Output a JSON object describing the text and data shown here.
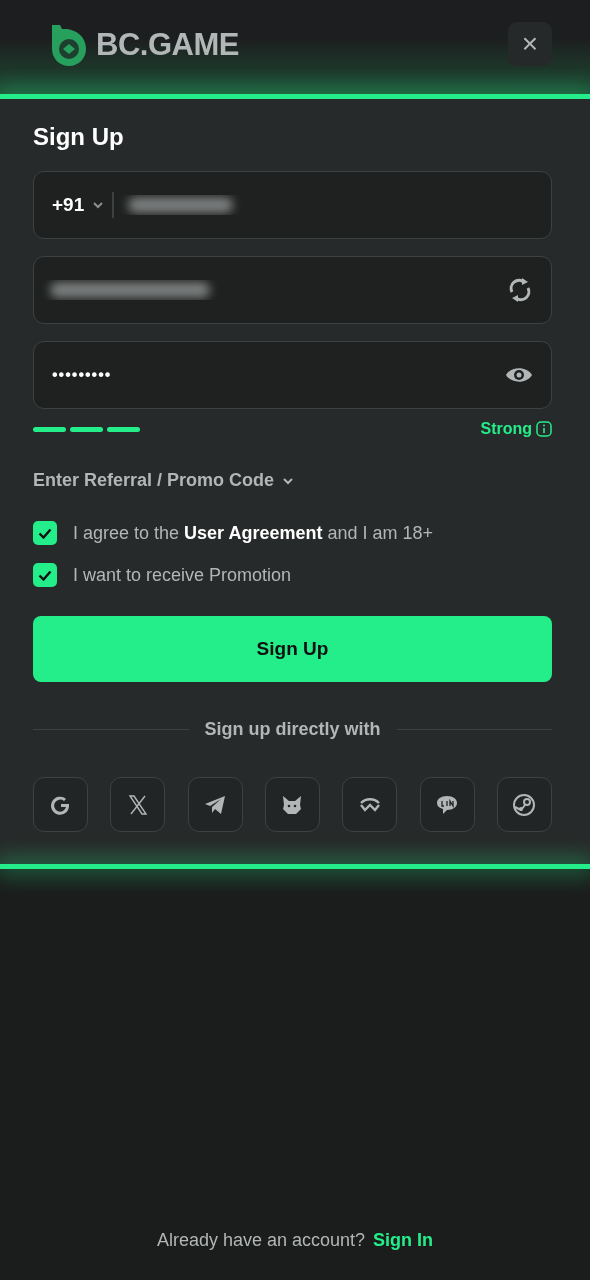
{
  "header": {
    "logo_text": "BC.GAME",
    "close": "×"
  },
  "form": {
    "title": "Sign Up",
    "phone": {
      "country_code": "+91",
      "value_blurred": true
    },
    "username": {
      "value_blurred": true
    },
    "password": {
      "value": "•••••••••",
      "masked": true
    },
    "strength": {
      "segments": [
        {
          "on": true
        },
        {
          "on": true
        },
        {
          "on": true
        }
      ],
      "label": "Strong"
    },
    "referral": {
      "label": "Enter Referral / Promo Code",
      "expanded": false
    },
    "checkboxes": [
      {
        "text": "I agree to the **User Agreement** and I am 18+",
        "checked": true
      },
      {
        "text": "I want to receive Promotion",
        "checked": true
      }
    ],
    "submit": "Sign Up",
    "divider_text": "Sign up directly with",
    "social": [
      {
        "kind": "google"
      },
      {
        "kind": "x"
      },
      {
        "kind": "telegram"
      },
      {
        "kind": "fox"
      },
      {
        "kind": "wave"
      },
      {
        "kind": "chat"
      },
      {
        "kind": "steam"
      }
    ]
  },
  "footer": {
    "text": "Already have an account?",
    "link": "Sign In"
  }
}
